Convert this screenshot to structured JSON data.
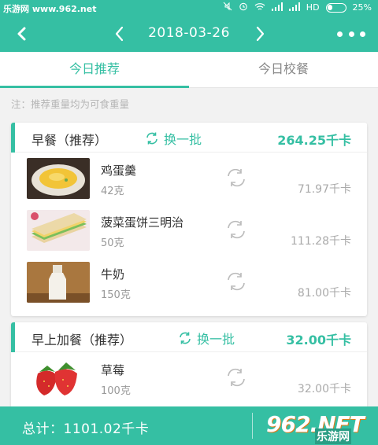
{
  "status_bar": {
    "watermark": "乐游网 www.962.net",
    "network": "HD",
    "battery": "25%"
  },
  "header": {
    "date": "2018-03-26"
  },
  "tabs": [
    {
      "label": "今日推荐",
      "active": true
    },
    {
      "label": "今日校餐",
      "active": false
    }
  ],
  "note": "注：推荐重量均为可食重量",
  "meals": [
    {
      "title": "早餐（推荐）",
      "swap_label": "换一批",
      "total": "264.25千卡",
      "foods": [
        {
          "name": "鸡蛋羹",
          "weight": "42克",
          "kcal": "71.97千卡",
          "image": "egg-custard"
        },
        {
          "name": "菠菜蛋饼三明治",
          "weight": "50克",
          "kcal": "111.28千卡",
          "image": "sandwich"
        },
        {
          "name": "牛奶",
          "weight": "150克",
          "kcal": "81.00千卡",
          "image": "milk"
        }
      ]
    },
    {
      "title": "早上加餐（推荐）",
      "swap_label": "换一批",
      "total": "32.00千卡",
      "foods": [
        {
          "name": "草莓",
          "weight": "100克",
          "kcal": "32.00千卡",
          "image": "strawberry"
        }
      ]
    }
  ],
  "footer": {
    "total": "总计：1101.02千卡",
    "logo_text": "962.NET",
    "logo_sub": "乐游网"
  },
  "colors": {
    "accent": "#35bfa3",
    "background": "#f2f2f2"
  }
}
